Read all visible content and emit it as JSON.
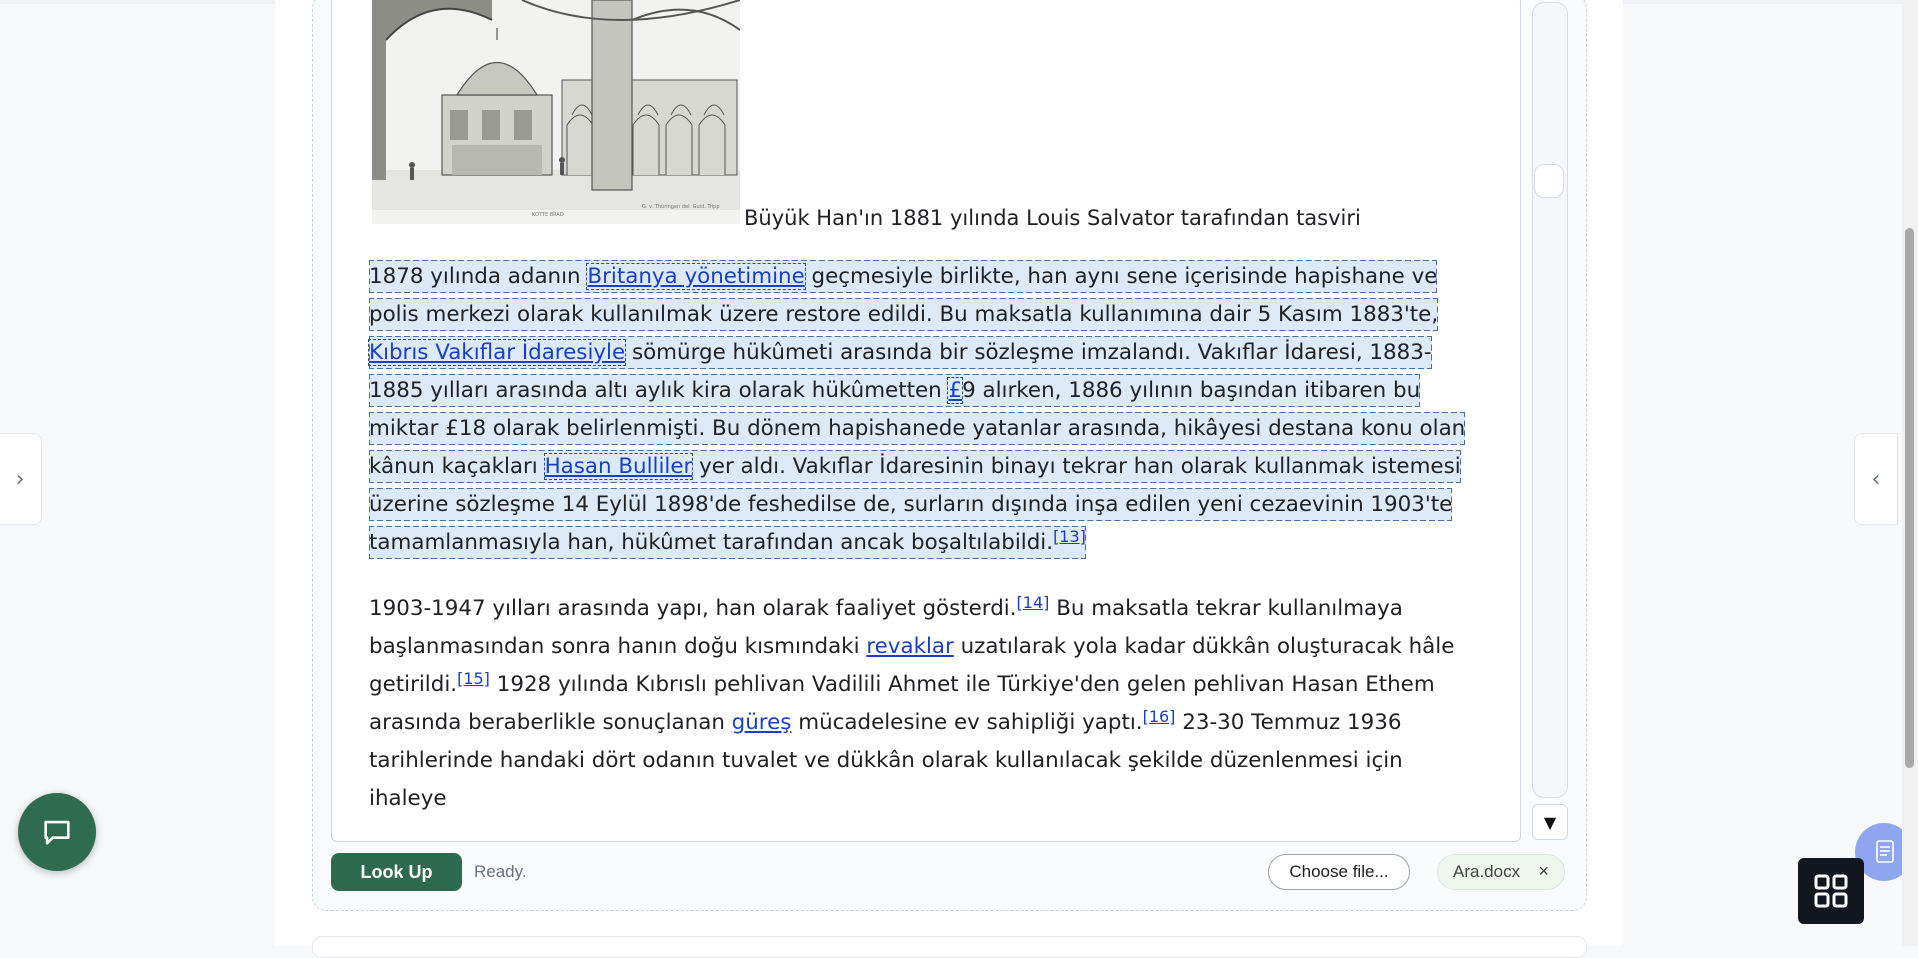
{
  "figure": {
    "caption": "Büyük Han'ın 1881 yılında Louis Salvator tarafından tasviri",
    "scribble_left": "KOTTE BRAD",
    "scribble_right": "G. v. Thüringen del. Guid. Tripp"
  },
  "para1": {
    "s1": "1878 yılında adanın ",
    "l1": "Britanya yönetimine",
    "s2": " geçmesiyle birlikte, han aynı sene içerisinde hapishane ve polis merkezi olarak kullanılmak üzere restore edildi. Bu maksatla kullanımına dair 5 Kasım 1883'te, ",
    "l2": "Kıbrıs Vakıflar İdaresiyle",
    "s3": " sömürge hükûmeti arasında bir sözleşme imzalandı. Vakıflar İdaresi, 1883-1885 yılları arasında altı aylık kira olarak hükûmetten ",
    "l3": "£",
    "s4": "9 alırken, 1886 yılının başından itibaren bu miktar £18 olarak belirlenmişti. Bu dönem hapishanede yatanlar arasında, hikâyesi destana konu olan kânun kaçakları ",
    "l4": "Hasan Bulliler",
    "s5": " yer aldı. Vakıflar İdaresinin binayı tekrar han olarak kullanmak istemesi üzerine sözleşme 14 Eylül 1898'de feshedilse de, surların dışında inşa edilen yeni cezaevinin 1903'te tamamlanmasıyla han, hükûmet tarafından ancak boşaltılabildi.",
    "r1": "[13]"
  },
  "para2": {
    "s1": "1903-1947 yılları arasında yapı, han olarak faaliyet gösterdi.",
    "r1": "[14]",
    "s2": " Bu maksatla tekrar kullanılmaya başlanmasından sonra hanın doğu kısmındaki ",
    "l1": "revaklar",
    "s3": " uzatılarak yola kadar dükkân oluşturacak hâle getirildi.",
    "r2": "[15]",
    "s4": " 1928 yılında Kıbrıslı pehlivan Vadilili Ahmet ile Türkiye'den gelen pehlivan Hasan Ethem arasında beraberlikle sonuçlanan ",
    "l2": "güreş",
    "s5": " mücadelesine ev sahipliği yaptı.",
    "r3": "[16]",
    "s6": " 23-30 Temmuz 1936 tarihlerinde handaki dört odanın tuvalet ve dükkân olarak kullanılacak şekilde düzenlenmesi için ihaleye"
  },
  "toolbar": {
    "lookup_label": "Look Up",
    "status": "Ready.",
    "choose_file_label": "Choose file...",
    "file_name": "Ara.docx",
    "file_remove": "×"
  },
  "controls": {
    "scroll_down_glyph": "▼",
    "left_tab_glyph": "›",
    "right_tab_glyph": "‹"
  },
  "icons": {
    "chat": "chat-bubble-icon",
    "apps": "grid-icon",
    "document": "document-icon"
  },
  "colors": {
    "primary_green": "#2d6a4f",
    "link_blue": "#1a3fc7",
    "highlight": "#a2c8eb",
    "dark_fab": "#11161f"
  }
}
